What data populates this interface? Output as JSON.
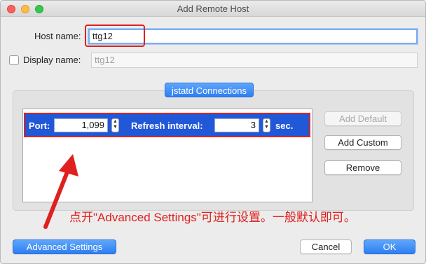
{
  "window": {
    "title": "Add Remote Host"
  },
  "form": {
    "host_label": "Host name:",
    "host_value": "ttg12",
    "display_label": "Display name:",
    "display_placeholder": "ttg12",
    "display_checked": false
  },
  "group": {
    "segment_label": "jstatd Connections",
    "row": {
      "port_label": "Port:",
      "port_value": "1,099",
      "refresh_label": "Refresh interval:",
      "refresh_value": "3",
      "unit": "sec."
    },
    "buttons": {
      "add_default": "Add Default",
      "add_custom": "Add Custom",
      "remove": "Remove"
    }
  },
  "annotation": {
    "text": "点开\"Advanced Settings\"可进行设置。一般默认即可。",
    "color": "#e0201e"
  },
  "footer": {
    "advanced": "Advanced Settings",
    "cancel": "Cancel",
    "ok": "OK"
  },
  "colors": {
    "accent": "#2f7ef2",
    "selection": "#2058d8",
    "annotation": "#e0201e"
  }
}
